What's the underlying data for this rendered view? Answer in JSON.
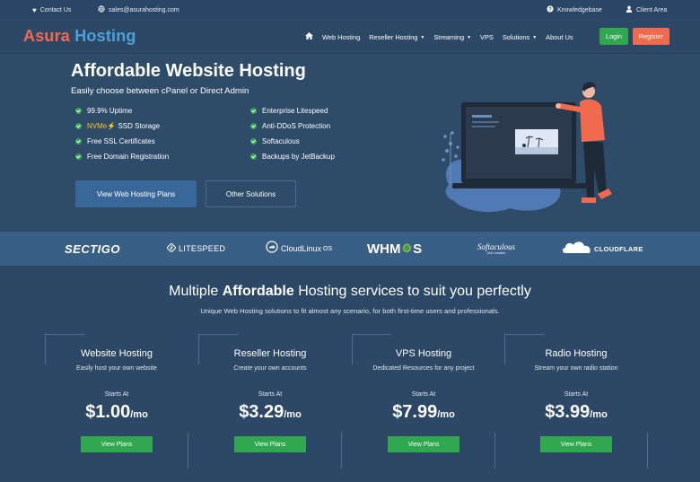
{
  "topbar": {
    "contact": "Contact Us",
    "email": "sales@asurahosting.com",
    "knowledgebase": "Knowledgebase",
    "client_area": "Client Area"
  },
  "brand": {
    "name_a": "Asura",
    "name_b": "Hosting",
    "color_a": "#f26a4e",
    "color_b": "#4ea1d8"
  },
  "nav": {
    "items": [
      "Web Hosting",
      "Reseller Hosting",
      "Streaming",
      "VPS",
      "Solutions",
      "About Us"
    ],
    "login": "Login",
    "register": "Register"
  },
  "hero": {
    "title": "Affordable Website Hosting",
    "subtitle": "Easily choose between cPanel or Direct Admin",
    "features_left": [
      "99.9% Uptime",
      "SSD Storage",
      "Free SSL Certificates",
      "Free Domain Registration"
    ],
    "nvme": "NVMe",
    "features_right": [
      "Enterprise Litespeed",
      "Anti-DDoS Protection",
      "Softaculous",
      "Backups by JetBackup"
    ],
    "btn_primary": "View Web Hosting Plans",
    "btn_secondary": "Other Solutions"
  },
  "partners": {
    "sectigo": "SECTIGO",
    "litespeed": "LITESPEED",
    "cloudlinux": "CloudLinux",
    "cloudlinux_os": "OS",
    "whmcs_a": "WHM",
    "whmcs_b": "S",
    "softaculous": "Softaculous",
    "softaculous_sub": "Auto Installer",
    "cloudflare": "CLOUDFLARE"
  },
  "services": {
    "title_a": "Multiple",
    "title_b": "Affordable",
    "title_c": "Hosting services to suit you perfectly",
    "subtitle": "Unique Web Hosting solutions to fit almost any scenario, for both first-time users and professionals.",
    "cards": [
      {
        "name": "Website Hosting",
        "desc": "Easily host your own website",
        "starts": "Starts At",
        "price": "$1.00",
        "per": "/mo",
        "button": "View Plans"
      },
      {
        "name": "Reseller Hosting",
        "desc": "Create your own accounts",
        "starts": "Starts At",
        "price": "$3.29",
        "per": "/mo",
        "button": "View Plans"
      },
      {
        "name": "VPS Hosting",
        "desc": "Dedicated Resources for any project",
        "starts": "Starts At",
        "price": "$7.99",
        "per": "/mo",
        "button": "View Plans"
      },
      {
        "name": "Radio Hosting",
        "desc": "Stream your own radio station",
        "starts": "Starts At",
        "price": "$3.99",
        "per": "/mo",
        "button": "View Plans"
      }
    ]
  },
  "colors": {
    "accent_green": "#2fa84f",
    "accent_orange": "#f26a4e",
    "bg": "#2c4866"
  }
}
